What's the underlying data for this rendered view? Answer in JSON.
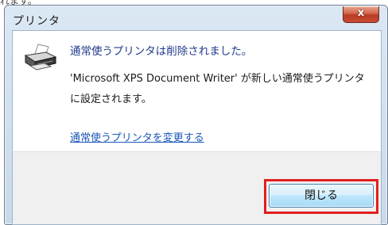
{
  "dialog": {
    "title": "プリンタ",
    "close_glyph": "x"
  },
  "message": {
    "main": "通常使うプリンタは削除されました。",
    "detail": "'Microsoft XPS Document Writer' が新しい通常使うプリンタに設定されます。",
    "link": "通常使うプリンタを変更する"
  },
  "footer": {
    "close_button_label": "閉じる"
  },
  "icons": {
    "printer": "printer-icon",
    "close": "close-icon"
  },
  "colors": {
    "highlight": "#e21f1f",
    "link": "#1a56b8",
    "main_message": "#1f3a8c"
  }
}
